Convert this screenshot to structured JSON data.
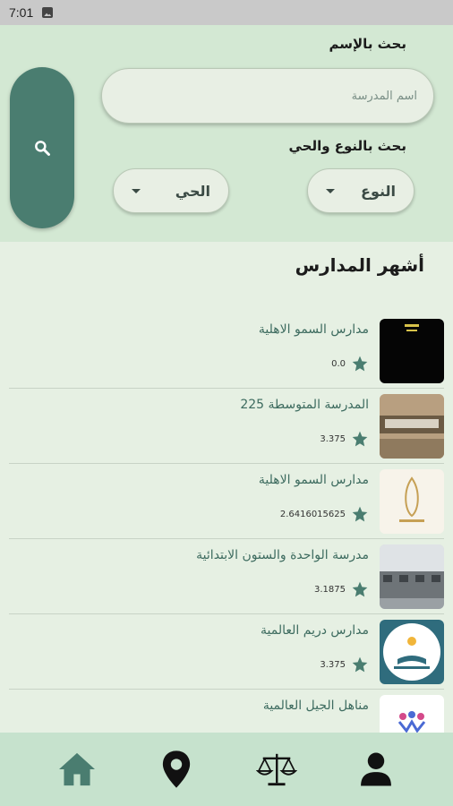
{
  "status_bar": {
    "time": "7:01"
  },
  "search": {
    "by_name_label": "بحث بالإسم",
    "name_placeholder": "اسم المدرسة",
    "by_type_label": "بحث بالنوع والحي",
    "type_dropdown": "النوع",
    "district_dropdown": "الحي"
  },
  "section_title": "أشهر المدارس",
  "schools": [
    {
      "name": "مدارس السمو الاهلية",
      "rating": "0.0",
      "thumb": "black"
    },
    {
      "name": "المدرسة المتوسطة 225",
      "rating": "3.375",
      "thumb": "building-sign"
    },
    {
      "name": "مدارس السمو الاهلية",
      "rating": "2.6416015625",
      "thumb": "logo-gold"
    },
    {
      "name": "مدرسة الواحدة والستون الابتدائية",
      "rating": "3.1875",
      "thumb": "building-gray"
    },
    {
      "name": "مدارس دريم العالمية",
      "rating": "3.375",
      "thumb": "dream-logo"
    },
    {
      "name": "مناهل الجيل العالمية",
      "rating": "",
      "thumb": "manahel-logo"
    }
  ],
  "colors": {
    "accent": "#4a7d70",
    "panel": "#d3e8d3",
    "nav": "#c6e2cd"
  },
  "nav": [
    "home-icon",
    "location-pin-icon",
    "scales-icon",
    "person-icon"
  ]
}
